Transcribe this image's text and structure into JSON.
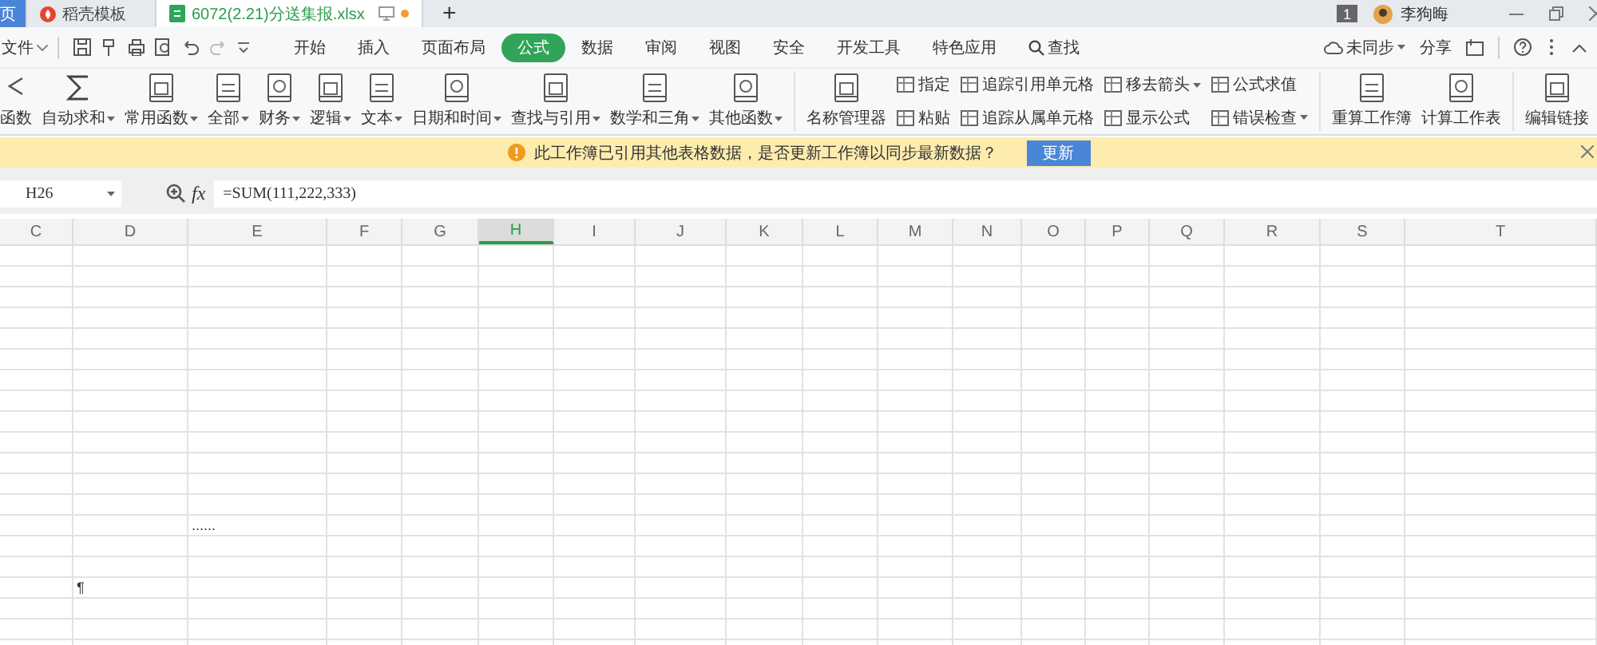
{
  "tabs": [
    {
      "label": "页",
      "kind": "home",
      "selected": false
    },
    {
      "label": "稻壳模板",
      "kind": "docer",
      "selected": false
    },
    {
      "label": "6072(2.21)分送集报.xlsx",
      "kind": "sheet",
      "selected": true,
      "unsaved": true
    }
  ],
  "new_tab": "+",
  "account": {
    "badge": "1",
    "name": "李狗晦"
  },
  "menu": {
    "file": "文件",
    "tabs": [
      {
        "label": "开始",
        "selected": false
      },
      {
        "label": "插入",
        "selected": false
      },
      {
        "label": "页面布局",
        "selected": false
      },
      {
        "label": "公式",
        "selected": true
      },
      {
        "label": "数据",
        "selected": false
      },
      {
        "label": "审阅",
        "selected": false
      },
      {
        "label": "视图",
        "selected": false
      },
      {
        "label": "安全",
        "selected": false
      },
      {
        "label": "开发工具",
        "selected": false
      },
      {
        "label": "特色应用",
        "selected": false
      }
    ],
    "search": "查找",
    "sync": "未同步",
    "share": "分享"
  },
  "ribbon": [
    {
      "kind": "large",
      "label": "函数",
      "menu": false
    },
    {
      "kind": "large",
      "label": "自动求和",
      "menu": true
    },
    {
      "kind": "large",
      "label": "常用函数",
      "menu": true
    },
    {
      "kind": "large",
      "label": "全部",
      "menu": true
    },
    {
      "kind": "large",
      "label": "财务",
      "menu": true
    },
    {
      "kind": "large",
      "label": "逻辑",
      "menu": true
    },
    {
      "kind": "large",
      "label": "文本",
      "menu": true
    },
    {
      "kind": "large",
      "label": "日期和时间",
      "menu": true
    },
    {
      "kind": "large",
      "label": "查找与引用",
      "menu": true
    },
    {
      "kind": "large",
      "label": "数学和三角",
      "menu": true
    },
    {
      "kind": "large",
      "label": "其他函数",
      "menu": true
    },
    {
      "kind": "separator"
    },
    {
      "kind": "large",
      "label": "名称管理器",
      "menu": false
    },
    {
      "kind": "stack",
      "items": [
        {
          "label": "指定",
          "menu": false
        },
        {
          "label": "粘贴",
          "menu": false
        }
      ]
    },
    {
      "kind": "stack",
      "items": [
        {
          "label": "追踪引用单元格",
          "menu": false
        },
        {
          "label": "追踪从属单元格",
          "menu": false
        }
      ]
    },
    {
      "kind": "stack",
      "items": [
        {
          "label": "移去箭头",
          "menu": true
        },
        {
          "label": "显示公式",
          "menu": false
        }
      ]
    },
    {
      "kind": "stack",
      "items": [
        {
          "label": "公式求值",
          "menu": false
        },
        {
          "label": "错误检查",
          "menu": true
        }
      ]
    },
    {
      "kind": "separator"
    },
    {
      "kind": "large",
      "label": "重算工作簿",
      "menu": false
    },
    {
      "kind": "large",
      "label": "计算工作表",
      "menu": false
    },
    {
      "kind": "separator"
    },
    {
      "kind": "large",
      "label": "编辑链接",
      "menu": false
    }
  ],
  "notice": {
    "text": "此工作簿已引用其他表格数据，是否更新工作簿以同步最新数据？",
    "button": "更新"
  },
  "formula_bar": {
    "cell": "H26",
    "function_symbol": "fx",
    "formula": "=SUM(111,222,333)"
  },
  "columns": [
    {
      "label": "C",
      "selected": false
    },
    {
      "label": "D",
      "selected": false
    },
    {
      "label": "E",
      "selected": false
    },
    {
      "label": "F",
      "selected": false
    },
    {
      "label": "G",
      "selected": false
    },
    {
      "label": "H",
      "selected": true
    },
    {
      "label": "I",
      "selected": false
    },
    {
      "label": "J",
      "selected": false
    },
    {
      "label": "K",
      "selected": false
    },
    {
      "label": "L",
      "selected": false
    },
    {
      "label": "M",
      "selected": false
    },
    {
      "label": "N",
      "selected": false
    },
    {
      "label": "O",
      "selected": false
    },
    {
      "label": "P",
      "selected": false
    },
    {
      "label": "Q",
      "selected": false
    },
    {
      "label": "R",
      "selected": false
    },
    {
      "label": "S",
      "selected": false
    },
    {
      "label": "T",
      "selected": false
    }
  ],
  "rows": [
    {},
    {},
    {},
    {},
    {},
    {},
    {},
    {},
    {},
    {},
    {},
    {},
    {},
    {
      "E": "......"
    },
    {},
    {},
    {
      "D": "¶"
    },
    {},
    {},
    {},
    {}
  ]
}
